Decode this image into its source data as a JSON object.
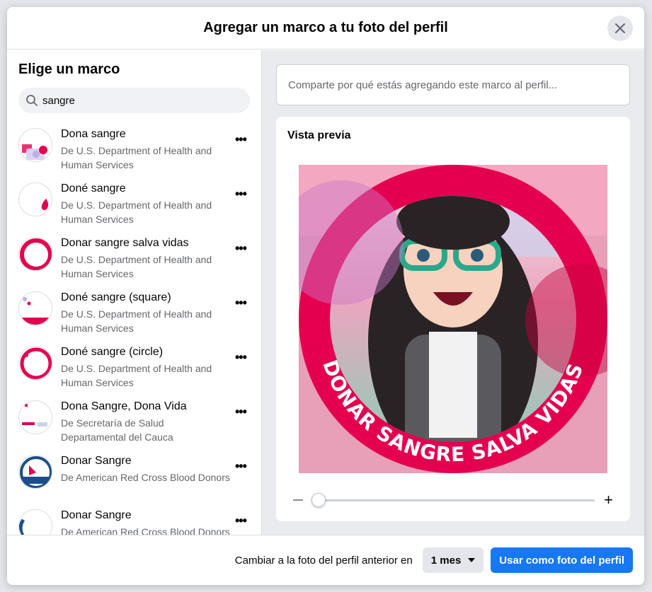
{
  "dialog": {
    "title": "Agregar un marco a tu foto del perfil",
    "close_icon": "close-icon"
  },
  "sidebar": {
    "heading": "Elige un marco",
    "search": {
      "value": "sangre",
      "icon": "search-icon"
    },
    "frames": [
      {
        "name": "Dona sangre",
        "publisher": "De U.S. Department of Health and Human Services"
      },
      {
        "name": "Doné sangre",
        "publisher": "De U.S. Department of Health and Human Services"
      },
      {
        "name": "Donar sangre salva vidas",
        "publisher": "De U.S. Department of Health and Human Services"
      },
      {
        "name": "Doné sangre (square)",
        "publisher": "De U.S. Department of Health and Human Services"
      },
      {
        "name": "Doné sangre (circle)",
        "publisher": "De U.S. Department of Health and Human Services"
      },
      {
        "name": "Dona Sangre, Dona Vida",
        "publisher": "De Secretaría de Salud Departamental del Cauca"
      },
      {
        "name": "Donar Sangre",
        "publisher": "De American Red Cross Blood Donors"
      },
      {
        "name": "Donar Sangre",
        "publisher": "De American Red Cross Blood Donors"
      }
    ],
    "more_icon": "more-horizontal-icon"
  },
  "main": {
    "caption_placeholder": "Comparte por qué estás agregando este marco al perfil...",
    "preview": {
      "title": "Vista previa",
      "frame_text": "DONAR SANGRE SALVA VIDAS",
      "zoom_level": 0,
      "colors": {
        "frame": "#e5004f",
        "background": "#f4a7c0"
      }
    }
  },
  "footer": {
    "revert_label": "Cambiar a la foto del perfil anterior en",
    "duration": "1 mes",
    "use_button": "Usar como foto del perfil",
    "accent": "#1877f2"
  }
}
